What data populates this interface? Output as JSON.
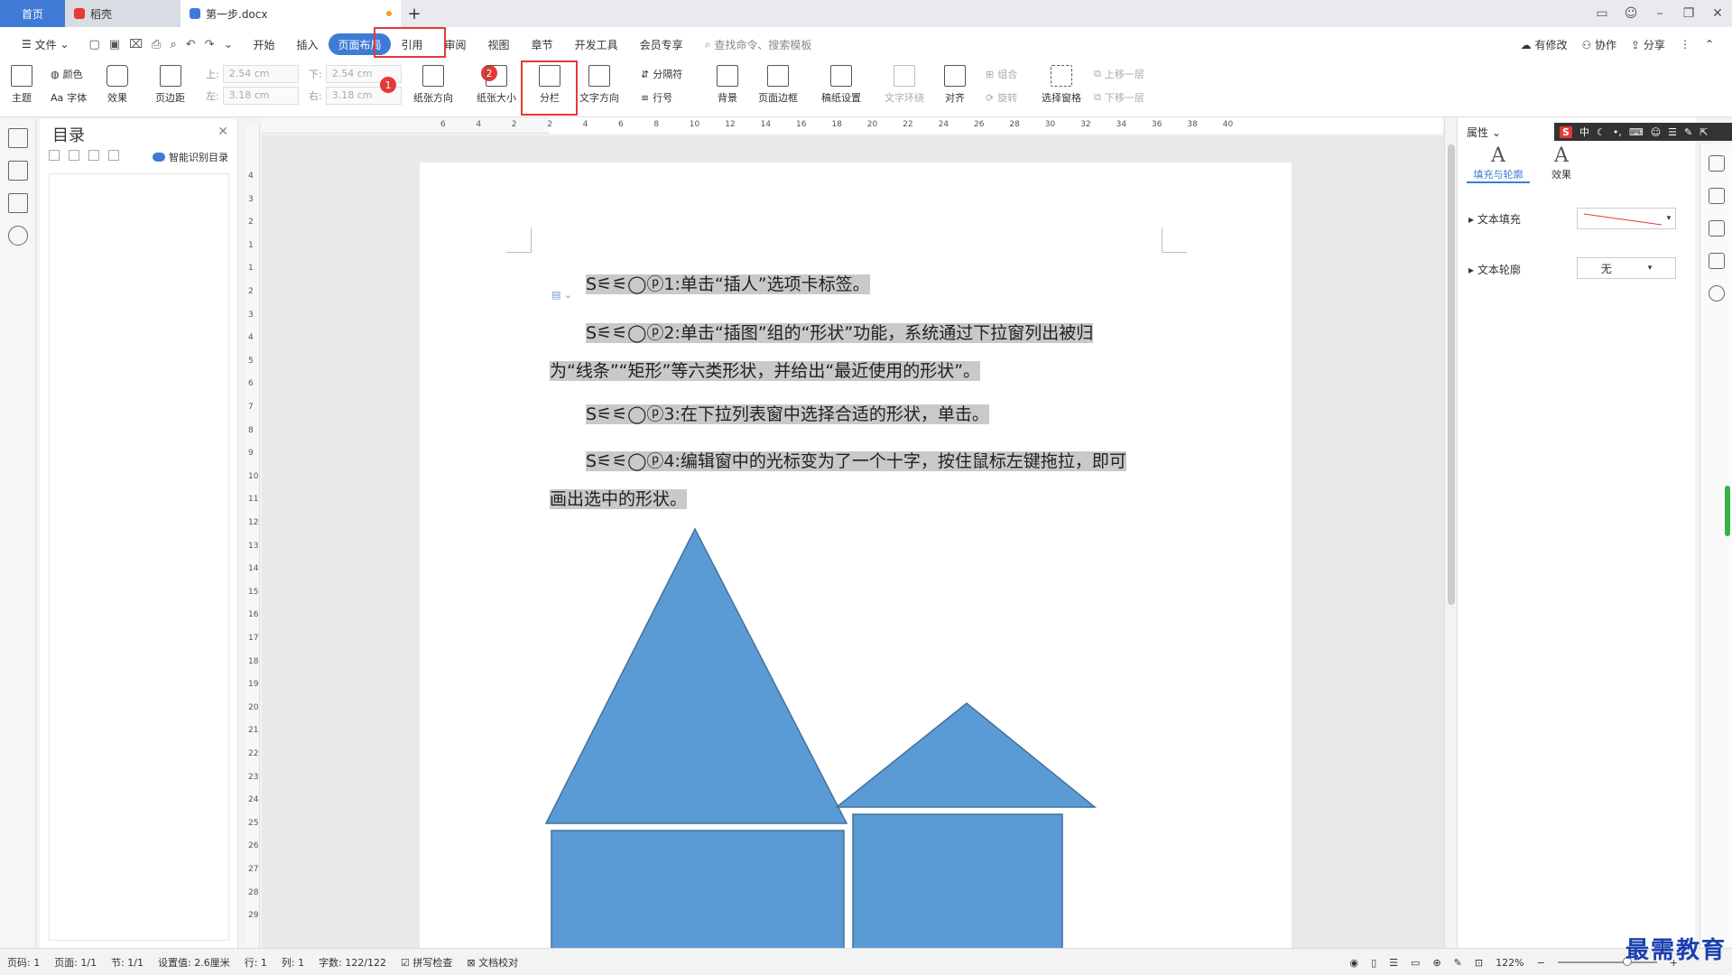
{
  "tabs": {
    "home": "首页",
    "daoke": "稻壳",
    "doc": "第一步.docx",
    "add": "+"
  },
  "menu": {
    "file": "文件",
    "items": [
      "开始",
      "插入",
      "页面布局",
      "引用",
      "审阅",
      "视图",
      "章节",
      "开发工具",
      "会员专享"
    ],
    "search": "查找命令、搜索模板",
    "right": [
      "有修改",
      "协作",
      "分享"
    ]
  },
  "ribbon": {
    "theme": "主题",
    "color": "颜色",
    "font": "字体",
    "effect": "效果",
    "margin": "页边距",
    "top_label": "上:",
    "top_val": "2.54 cm",
    "bottom_label": "下:",
    "bottom_val": "2.54 cm",
    "left_label": "左:",
    "left_val": "3.18 cm",
    "right_label": "右:",
    "right_val": "3.18 cm",
    "orientation": "纸张方向",
    "size": "纸张大小",
    "columns": "分栏",
    "text_dir": "文字方向",
    "separator": "分隔符",
    "line_no": "行号",
    "background": "背景",
    "page_border": "页面边框",
    "manuscript": "稿纸设置",
    "text_wrap": "文字环绕",
    "align": "对齐",
    "group": "组合",
    "rotate": "旋转",
    "select_pane": "选择窗格",
    "up": "上移一层",
    "down": "下移一层",
    "badge1": "1",
    "badge2": "2"
  },
  "toc": {
    "title": "目录",
    "smart": "智能识别目录"
  },
  "document": {
    "p1": "S⚟⚟◯ⓟ1:单击“插人”选项卡标签。",
    "p2a": "S⚟⚟◯ⓟ2:单击“插图”组的“形状”功能，系统通过下拉窗列出被归",
    "p2b": "为“线条”“矩形”等六类形状，并给出“最近使用的形状”。",
    "p3": "S⚟⚟◯ⓟ3:在下拉列表窗中选择合适的形状，单击。",
    "p4a": "S⚟⚟◯ⓟ4:编辑窗中的光标变为了一个十字，按住鼠标左键拖拉，即可",
    "p4b": "画出选中的形状。"
  },
  "ruler": {
    "h": [
      "6",
      "4",
      "2",
      "2",
      "4",
      "6",
      "8",
      "10",
      "12",
      "14",
      "16",
      "18",
      "20",
      "22",
      "24",
      "26",
      "28",
      "30",
      "32",
      "34",
      "36",
      "38",
      "40"
    ],
    "v": [
      "4",
      "3",
      "2",
      "1",
      "1",
      "2",
      "3",
      "4",
      "5",
      "6",
      "7",
      "8",
      "9",
      "10",
      "11",
      "12",
      "13",
      "14",
      "15",
      "16",
      "17",
      "18",
      "19",
      "20",
      "21",
      "22",
      "23",
      "24",
      "25",
      "26",
      "27",
      "28",
      "29"
    ]
  },
  "props": {
    "title": "属性",
    "tab_fill": "填充与轮廓",
    "tab_effect": "效果",
    "text_fill": "文本填充",
    "text_outline": "文本轮廓",
    "outline_val": "无"
  },
  "ime": "中",
  "status": {
    "page": "页码: 1",
    "pages": "页面: 1/1",
    "section": "节: 1/1",
    "setting": "设置值: 2.6厘米",
    "row": "行: 1",
    "col": "列: 1",
    "words": "字数: 122/122",
    "spell": "拼写检查",
    "proof": "文档校对",
    "zoom": "122%"
  },
  "watermark": "最需教育",
  "colors": {
    "accent": "#3f7bd6",
    "shape_fill": "#5b9bd5",
    "shape_stroke": "#41719c",
    "highlight": "#c9c9c9",
    "annotation": "#e53935"
  }
}
